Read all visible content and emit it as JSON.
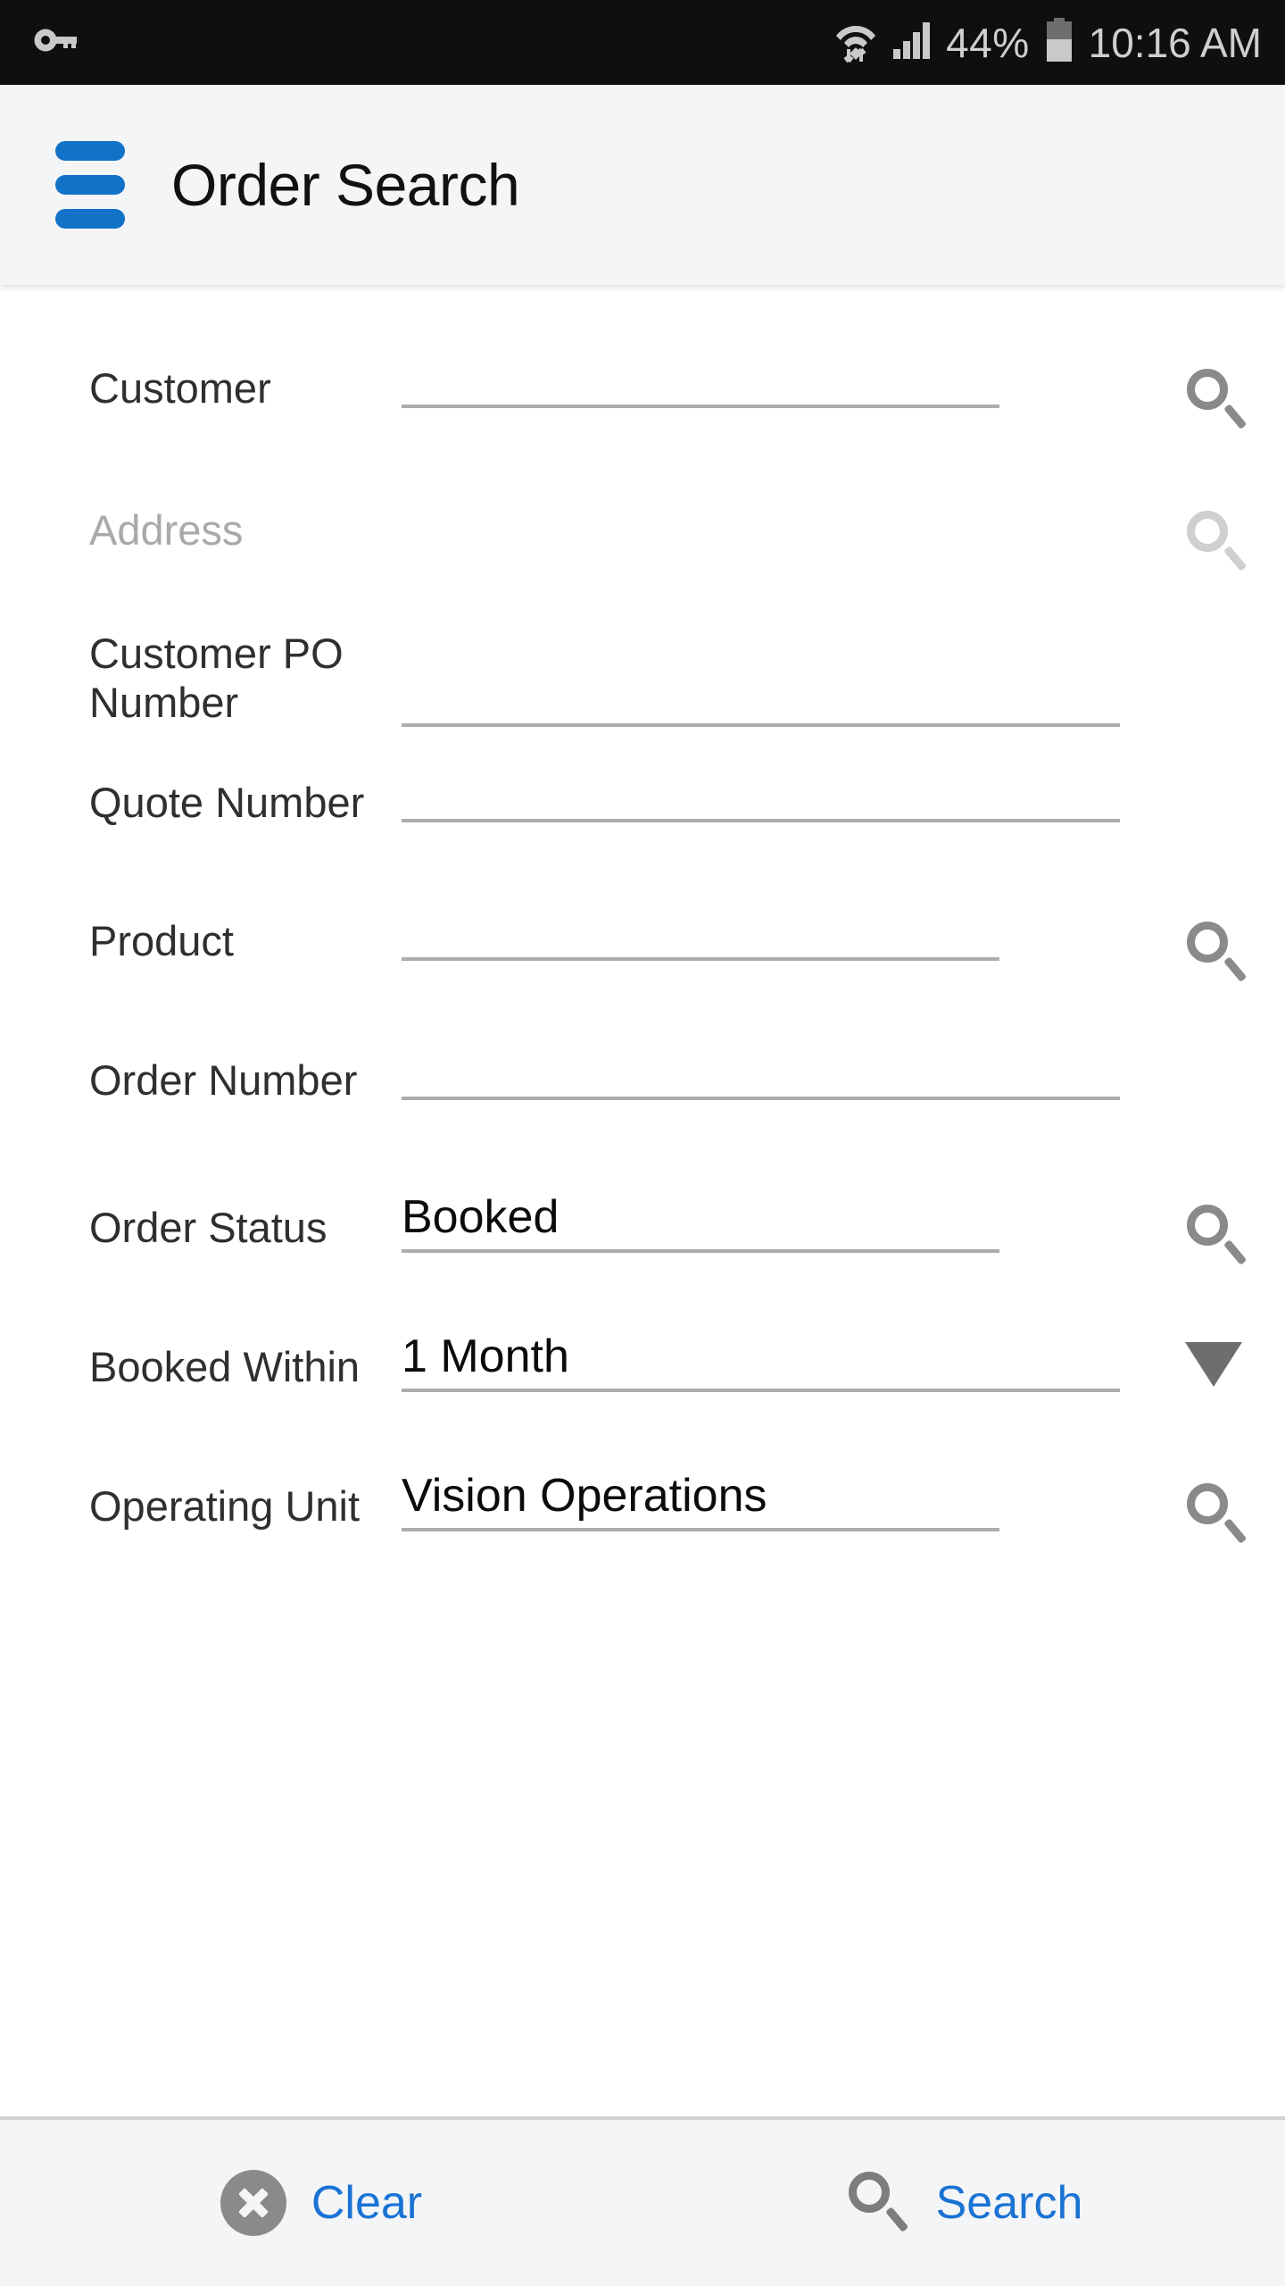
{
  "status_bar": {
    "vpn_key_icon": "key-icon",
    "wifi_icon": "wifi-icon",
    "signal_icon": "cellular-signal-icon",
    "battery_percent": "44%",
    "battery_icon": "battery-icon",
    "time": "10:16 AM"
  },
  "header": {
    "menu_icon": "hamburger-menu-icon",
    "title": "Order Search",
    "menu_color": "#1272c8",
    "background": "#f4f5f7"
  },
  "form": {
    "fields": [
      {
        "label": "Customer",
        "value": "",
        "icon": "search-icon",
        "line": "short",
        "disabled": false
      },
      {
        "label": "Address",
        "value": "",
        "icon": "search-icon",
        "line": "none",
        "disabled": true
      },
      {
        "label": "Customer PO\nNumber",
        "value": "",
        "icon": "none",
        "line": "full",
        "disabled": false
      },
      {
        "label": "Quote Number",
        "value": "",
        "icon": "none",
        "line": "full",
        "disabled": false
      },
      {
        "label": "Product",
        "value": "",
        "icon": "search-icon",
        "line": "short",
        "disabled": false
      },
      {
        "label": "Order Number",
        "value": "",
        "icon": "none",
        "line": "full",
        "disabled": false
      },
      {
        "label": "Order Status",
        "value": "Booked",
        "icon": "search-icon",
        "line": "short",
        "disabled": false
      },
      {
        "label": "Booked Within",
        "value": "1 Month",
        "icon": "chevron-down-icon",
        "line": "full",
        "disabled": false
      },
      {
        "label": "Operating Unit",
        "value": "Vision Operations",
        "icon": "search-icon",
        "line": "short",
        "disabled": false
      }
    ]
  },
  "bottom_bar": {
    "clear_label": "Clear",
    "clear_icon": "close-circle-icon",
    "search_label": "Search",
    "search_icon": "search-icon",
    "accent_color": "#1a73d4"
  }
}
